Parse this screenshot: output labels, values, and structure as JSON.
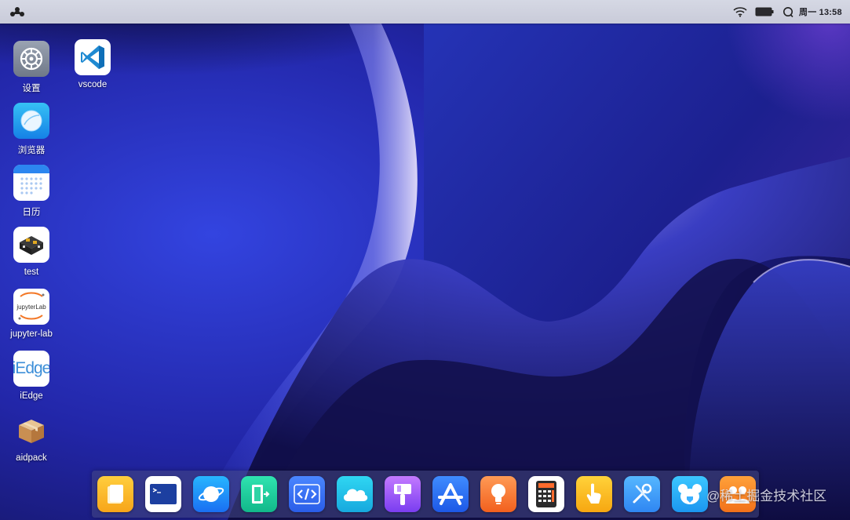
{
  "topbar": {
    "logo_icon": "kylin-logo-icon",
    "wifi_icon": "wifi-icon",
    "battery_icon": "battery-icon",
    "search_icon": "search-icon",
    "clock": "周一 13:58"
  },
  "desktop": {
    "icons": [
      {
        "label": "设置",
        "icon": "settings-gear-icon"
      },
      {
        "label": "vscode",
        "icon": "vscode-icon"
      },
      {
        "label": "浏览器",
        "icon": "browser-icon"
      },
      {
        "label": "日历",
        "icon": "calendar-icon"
      },
      {
        "label": "test",
        "icon": "chip-board-icon"
      },
      {
        "label": "jupyter-lab",
        "icon": "jupyterlab-icon"
      },
      {
        "label": "iEdge",
        "icon": "iedge-icon"
      },
      {
        "label": "aidpack",
        "icon": "package-box-icon"
      }
    ],
    "jupyter_logo_text": "jupyterLab",
    "iedge_logo_text": "iEdge"
  },
  "dock": {
    "apps": [
      {
        "name": "files",
        "icon": "folder-icon"
      },
      {
        "name": "terminal",
        "icon": "terminal-icon"
      },
      {
        "name": "browser",
        "icon": "planet-browser-icon"
      },
      {
        "name": "exit",
        "icon": "exit-door-icon"
      },
      {
        "name": "code",
        "icon": "code-brackets-icon"
      },
      {
        "name": "cloud",
        "icon": "cloud-icon"
      },
      {
        "name": "paint",
        "icon": "paint-roller-icon"
      },
      {
        "name": "app-store",
        "icon": "app-store-icon"
      },
      {
        "name": "tips",
        "icon": "lightbulb-icon"
      },
      {
        "name": "calculator",
        "icon": "calculator-icon"
      },
      {
        "name": "touch",
        "icon": "touch-hand-icon"
      },
      {
        "name": "tools",
        "icon": "tools-icon"
      },
      {
        "name": "kids",
        "icon": "bear-face-icon"
      },
      {
        "name": "people",
        "icon": "people-icon"
      }
    ]
  },
  "watermark": "@稀土掘金技术社区",
  "colors": {
    "topbar_bg": "#d0d3e0",
    "wallpaper_dark": "#120e48",
    "wallpaper_blue": "#2b3ad0",
    "wallpaper_light": "#d7d2f0"
  }
}
